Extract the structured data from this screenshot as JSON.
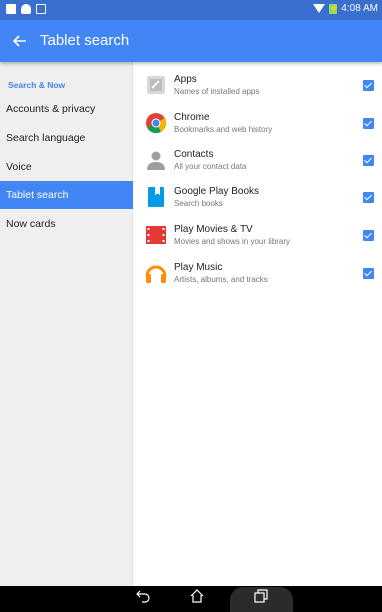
{
  "status_bar": {
    "time": "4:08 AM"
  },
  "app_bar": {
    "back_icon": "arrow-left-icon",
    "title": "Tablet search"
  },
  "sidebar": {
    "header": "Search & Now",
    "items": [
      {
        "label": "Accounts & privacy",
        "active": false
      },
      {
        "label": "Search language",
        "active": false
      },
      {
        "label": "Voice",
        "active": false
      },
      {
        "label": "Tablet search",
        "active": true
      },
      {
        "label": "Now cards",
        "active": false
      }
    ]
  },
  "sources": [
    {
      "title": "Apps",
      "subtitle": "Names of installed apps",
      "icon": "apps-icon",
      "checked": true
    },
    {
      "title": "Chrome",
      "subtitle": "Bookmarks and web history",
      "icon": "chrome-icon",
      "checked": true
    },
    {
      "title": "Contacts",
      "subtitle": "All your contact data",
      "icon": "contacts-icon",
      "checked": true
    },
    {
      "title": "Google Play Books",
      "subtitle": "Search books",
      "icon": "play-books-icon",
      "checked": true
    },
    {
      "title": "Play Movies & TV",
      "subtitle": "Movies and shows in your library",
      "icon": "play-movies-icon",
      "checked": true
    },
    {
      "title": "Play Music",
      "subtitle": "Artists, albums, and tracks",
      "icon": "play-music-icon",
      "checked": true
    }
  ],
  "colors": {
    "status_bar": "#3a6fd0",
    "app_bar": "#4285f4",
    "accent": "#4285f4",
    "sidebar_bg": "#efefef"
  }
}
